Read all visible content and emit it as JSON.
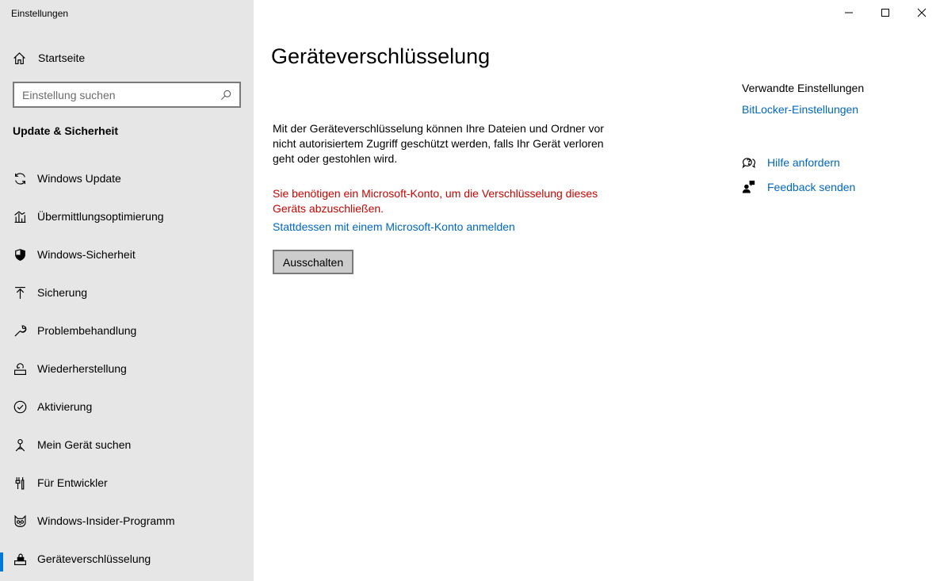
{
  "app": {
    "title": "Einstellungen"
  },
  "sidebar": {
    "home_label": "Startseite",
    "search_placeholder": "Einstellung suchen",
    "section_title": "Update & Sicherheit",
    "items": [
      {
        "label": "Windows Update",
        "icon": "sync-icon"
      },
      {
        "label": "Übermittlungsoptimierung",
        "icon": "delivery-optimization-icon"
      },
      {
        "label": "Windows-Sicherheit",
        "icon": "shield-icon"
      },
      {
        "label": "Sicherung",
        "icon": "backup-arrow-icon"
      },
      {
        "label": "Problembehandlung",
        "icon": "wrench-icon"
      },
      {
        "label": "Wiederherstellung",
        "icon": "recovery-icon"
      },
      {
        "label": "Aktivierung",
        "icon": "check-circle-icon"
      },
      {
        "label": "Mein Gerät suchen",
        "icon": "find-device-icon"
      },
      {
        "label": "Für Entwickler",
        "icon": "developer-tools-icon"
      },
      {
        "label": "Windows-Insider-Programm",
        "icon": "insider-cat-icon"
      },
      {
        "label": "Geräteverschlüsselung",
        "icon": "device-encryption-icon",
        "selected": true
      }
    ]
  },
  "main": {
    "title": "Geräteverschlüsselung",
    "description": "Mit der Geräteverschlüsselung können Ihre Dateien und Ordner vor nicht autorisiertem Zugriff geschützt werden, falls Ihr Gerät verloren geht oder gestohlen wird.",
    "warning": "Sie benötigen ein Microsoft-Konto, um die Verschlüsselung dieses Geräts abzuschließen.",
    "signin_link": "Stattdessen mit einem Microsoft-Konto anmelden",
    "off_button": "Ausschalten"
  },
  "related": {
    "title": "Verwandte Einstellungen",
    "bitlocker_link": "BitLocker-Einstellungen",
    "help_label": "Hilfe anfordern",
    "feedback_label": "Feedback senden"
  },
  "colors": {
    "accent": "#0078d7",
    "link": "#0067c0",
    "warning": "#c50500",
    "sidebar_bg": "#e6e6e6"
  }
}
